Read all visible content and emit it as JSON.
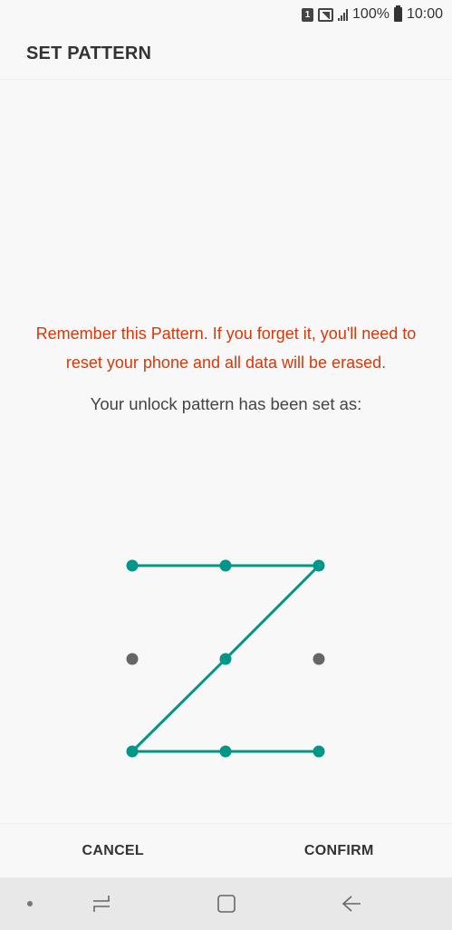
{
  "status_bar": {
    "sim_label": "1",
    "battery_percent": "100%",
    "time": "10:00"
  },
  "header": {
    "title": "SET PATTERN"
  },
  "main": {
    "warning": "Remember this Pattern. If you forget it, you'll need to reset your phone and all data will be erased.",
    "info": "Your unlock pattern has been set as:",
    "pattern_sequence": [
      1,
      2,
      3,
      5,
      7,
      8,
      9
    ],
    "colors": {
      "active": "#009688",
      "inactive": "#666666",
      "warning": "#d6390b"
    }
  },
  "buttons": {
    "cancel_label": "CANCEL",
    "confirm_label": "CONFIRM"
  },
  "nav_bar": {
    "icons": [
      "dot-icon",
      "recents-icon",
      "home-icon",
      "back-icon"
    ]
  }
}
